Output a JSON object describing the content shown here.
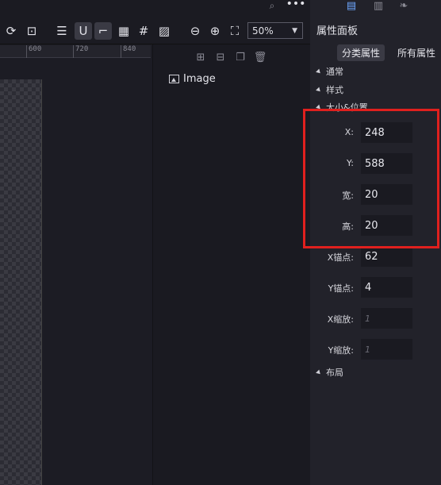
{
  "toolbar": {
    "zoom_value": "50%",
    "top_icons": [
      "search-doc-icon",
      "more-icon"
    ],
    "icons": [
      "refresh-icon",
      "export-icon",
      "database-icon",
      "magnet-icon",
      "align-icon",
      "grid-icon",
      "hash-grid-icon",
      "image-frame-icon",
      "zoom-out-icon",
      "zoom-in-icon",
      "fit-screen-icon"
    ]
  },
  "ruler": {
    "labels": [
      "600",
      "720",
      "840"
    ]
  },
  "layers": {
    "tools": [
      "group-icon",
      "ungroup-icon",
      "copy-icon",
      "delete-icon"
    ],
    "items": [
      {
        "label": "Image",
        "icon": "image-icon"
      }
    ]
  },
  "props": {
    "title": "属性面板",
    "tabs": {
      "classified": "分类属性",
      "all": "所有属性"
    },
    "sections": {
      "general": "通常",
      "style": "样式",
      "size_position": "大小&位置",
      "layout": "布局"
    },
    "fields": [
      {
        "label": "X:",
        "value": "248",
        "placeholder": false
      },
      {
        "label": "Y:",
        "value": "588",
        "placeholder": false
      },
      {
        "label": "宽:",
        "value": "20",
        "placeholder": false
      },
      {
        "label": "高:",
        "value": "20",
        "placeholder": false
      },
      {
        "label": "X锚点:",
        "value": "62",
        "placeholder": false
      },
      {
        "label": "Y锚点:",
        "value": "4",
        "placeholder": false
      },
      {
        "label": "X缩放:",
        "value": "1",
        "placeholder": true
      },
      {
        "label": "Y缩放:",
        "value": "1",
        "placeholder": true
      }
    ]
  },
  "colors": {
    "highlight": "#e0201e",
    "accent": "#6ea8ff"
  }
}
